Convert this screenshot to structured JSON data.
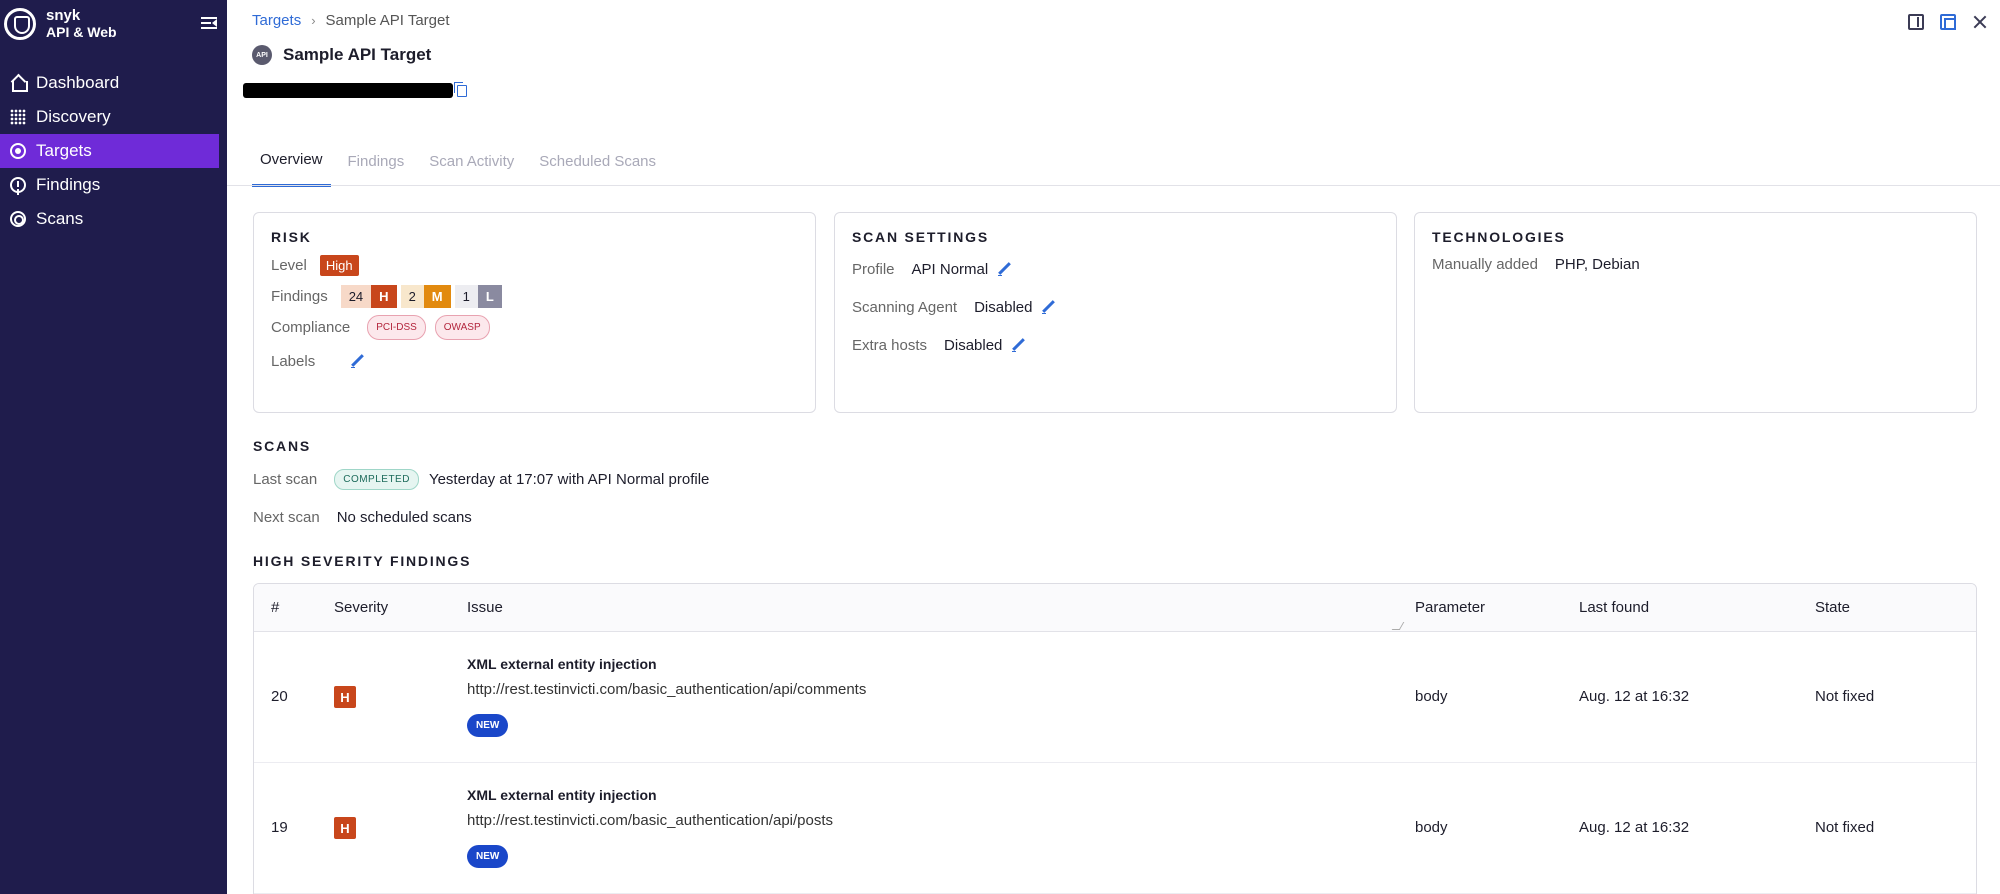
{
  "app": {
    "brand_title": "snyk",
    "brand_sub": "API & Web"
  },
  "sidebar": {
    "items": [
      {
        "label": "Dashboard",
        "icon": "home-icon"
      },
      {
        "label": "Discovery",
        "icon": "grid-icon"
      },
      {
        "label": "Targets",
        "icon": "target-icon",
        "active": true
      },
      {
        "label": "Findings",
        "icon": "info-icon"
      },
      {
        "label": "Scans",
        "icon": "scan-icon"
      }
    ]
  },
  "breadcrumb": {
    "parent": "Targets",
    "current": "Sample API Target"
  },
  "header": {
    "badge": "API",
    "title": "Sample API Target"
  },
  "tabs": [
    {
      "label": "Overview",
      "active": true
    },
    {
      "label": "Findings"
    },
    {
      "label": "Scan Activity"
    },
    {
      "label": "Scheduled Scans"
    }
  ],
  "risk": {
    "title": "RISK",
    "level_label": "Level",
    "level_value": "High",
    "findings_label": "Findings",
    "findings": {
      "high_count": "24",
      "high_letter": "H",
      "medium_count": "2",
      "medium_letter": "M",
      "low_count": "1",
      "low_letter": "L"
    },
    "compliance_label": "Compliance",
    "compliance": [
      "PCI-DSS",
      "OWASP"
    ],
    "labels_label": "Labels"
  },
  "scan_settings": {
    "title": "SCAN SETTINGS",
    "profile_label": "Profile",
    "profile_value": "API Normal",
    "agent_label": "Scanning Agent",
    "agent_value": "Disabled",
    "extra_label": "Extra hosts",
    "extra_value": "Disabled"
  },
  "technologies": {
    "title": "TECHNOLOGIES",
    "label": "Manually added",
    "value": "PHP, Debian"
  },
  "scans": {
    "title": "SCANS",
    "last_label": "Last scan",
    "last_status": "COMPLETED",
    "last_value": "Yesterday at 17:07 with API Normal profile",
    "next_label": "Next scan",
    "next_value": "No scheduled scans"
  },
  "high_findings": {
    "title": "HIGH SEVERITY FINDINGS",
    "columns": [
      "#",
      "Severity",
      "Issue",
      "Parameter",
      "Last found",
      "State"
    ],
    "rows": [
      {
        "num": "20",
        "sev": "H",
        "issue": "XML external entity injection",
        "url": "http://rest.testinvicti.com/basic_authentication/api/comments",
        "tag": "NEW",
        "param": "body",
        "last_found": "Aug. 12 at 16:32",
        "state": "Not fixed"
      },
      {
        "num": "19",
        "sev": "H",
        "issue": "XML external entity injection",
        "url": "http://rest.testinvicti.com/basic_authentication/api/posts",
        "tag": "NEW",
        "param": "body",
        "last_found": "Aug. 12 at 16:32",
        "state": "Not fixed"
      }
    ]
  },
  "colors": {
    "sidebar_bg": "#1f1c4c",
    "active_nav": "#6f2bd8",
    "accent": "#2f6bd6",
    "high": "#c8461b",
    "medium": "#e28a0f",
    "low": "#8a8aa0"
  }
}
